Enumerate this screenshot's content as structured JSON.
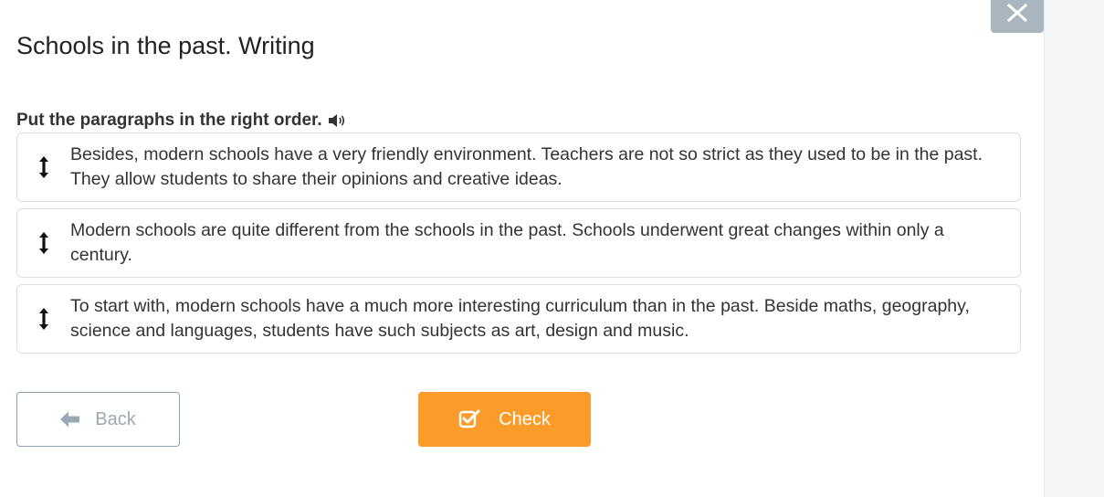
{
  "header": {
    "title": "Schools in the past. Writing"
  },
  "task": {
    "instruction": "Put the paragraphs in the right order."
  },
  "paragraphs": [
    {
      "text": "Besides, modern schools have a very friendly environment. Teachers are not so strict as they used to be in the past. They allow students to share their opinions and creative ideas."
    },
    {
      "text": "Modern schools are quite different from the schools in the past. Schools underwent great changes within only a century."
    },
    {
      "text": "To start with, modern schools have a much more interesting curriculum than in the past. Beside maths, geography, science and languages, students have such subjects as art, design and music."
    }
  ],
  "buttons": {
    "back_label": "Back",
    "check_label": "Check"
  },
  "icons": {
    "fullscreen": "expand-arrows-icon",
    "audio": "speaker-icon",
    "drag": "vertical-arrows-icon",
    "back": "arrow-left-icon",
    "check": "checkbox-icon"
  },
  "colors": {
    "accent": "#fb9c2a",
    "fullscreen_bg": "#a9b5bf",
    "back_border": "#8aa0b2",
    "back_text": "#9aa8b3",
    "item_border": "#dcdfe3",
    "side_panel": "#f4f6f8"
  }
}
